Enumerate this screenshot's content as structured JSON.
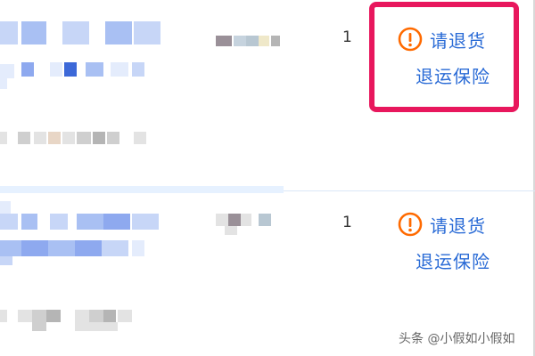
{
  "orders": [
    {
      "quantity": "1",
      "action_primary": "请退货",
      "action_secondary": "退运保险",
      "highlighted": true
    },
    {
      "quantity": "1",
      "action_primary": "请退货",
      "action_secondary": "退运保险",
      "highlighted": false
    }
  ],
  "colors": {
    "link": "#2a6bd6",
    "warning": "#ff6a00",
    "highlight_border": "#e8175d"
  },
  "icons": {
    "warning": "exclamation-circle-icon"
  },
  "watermark": "头条 @小假如小假如"
}
